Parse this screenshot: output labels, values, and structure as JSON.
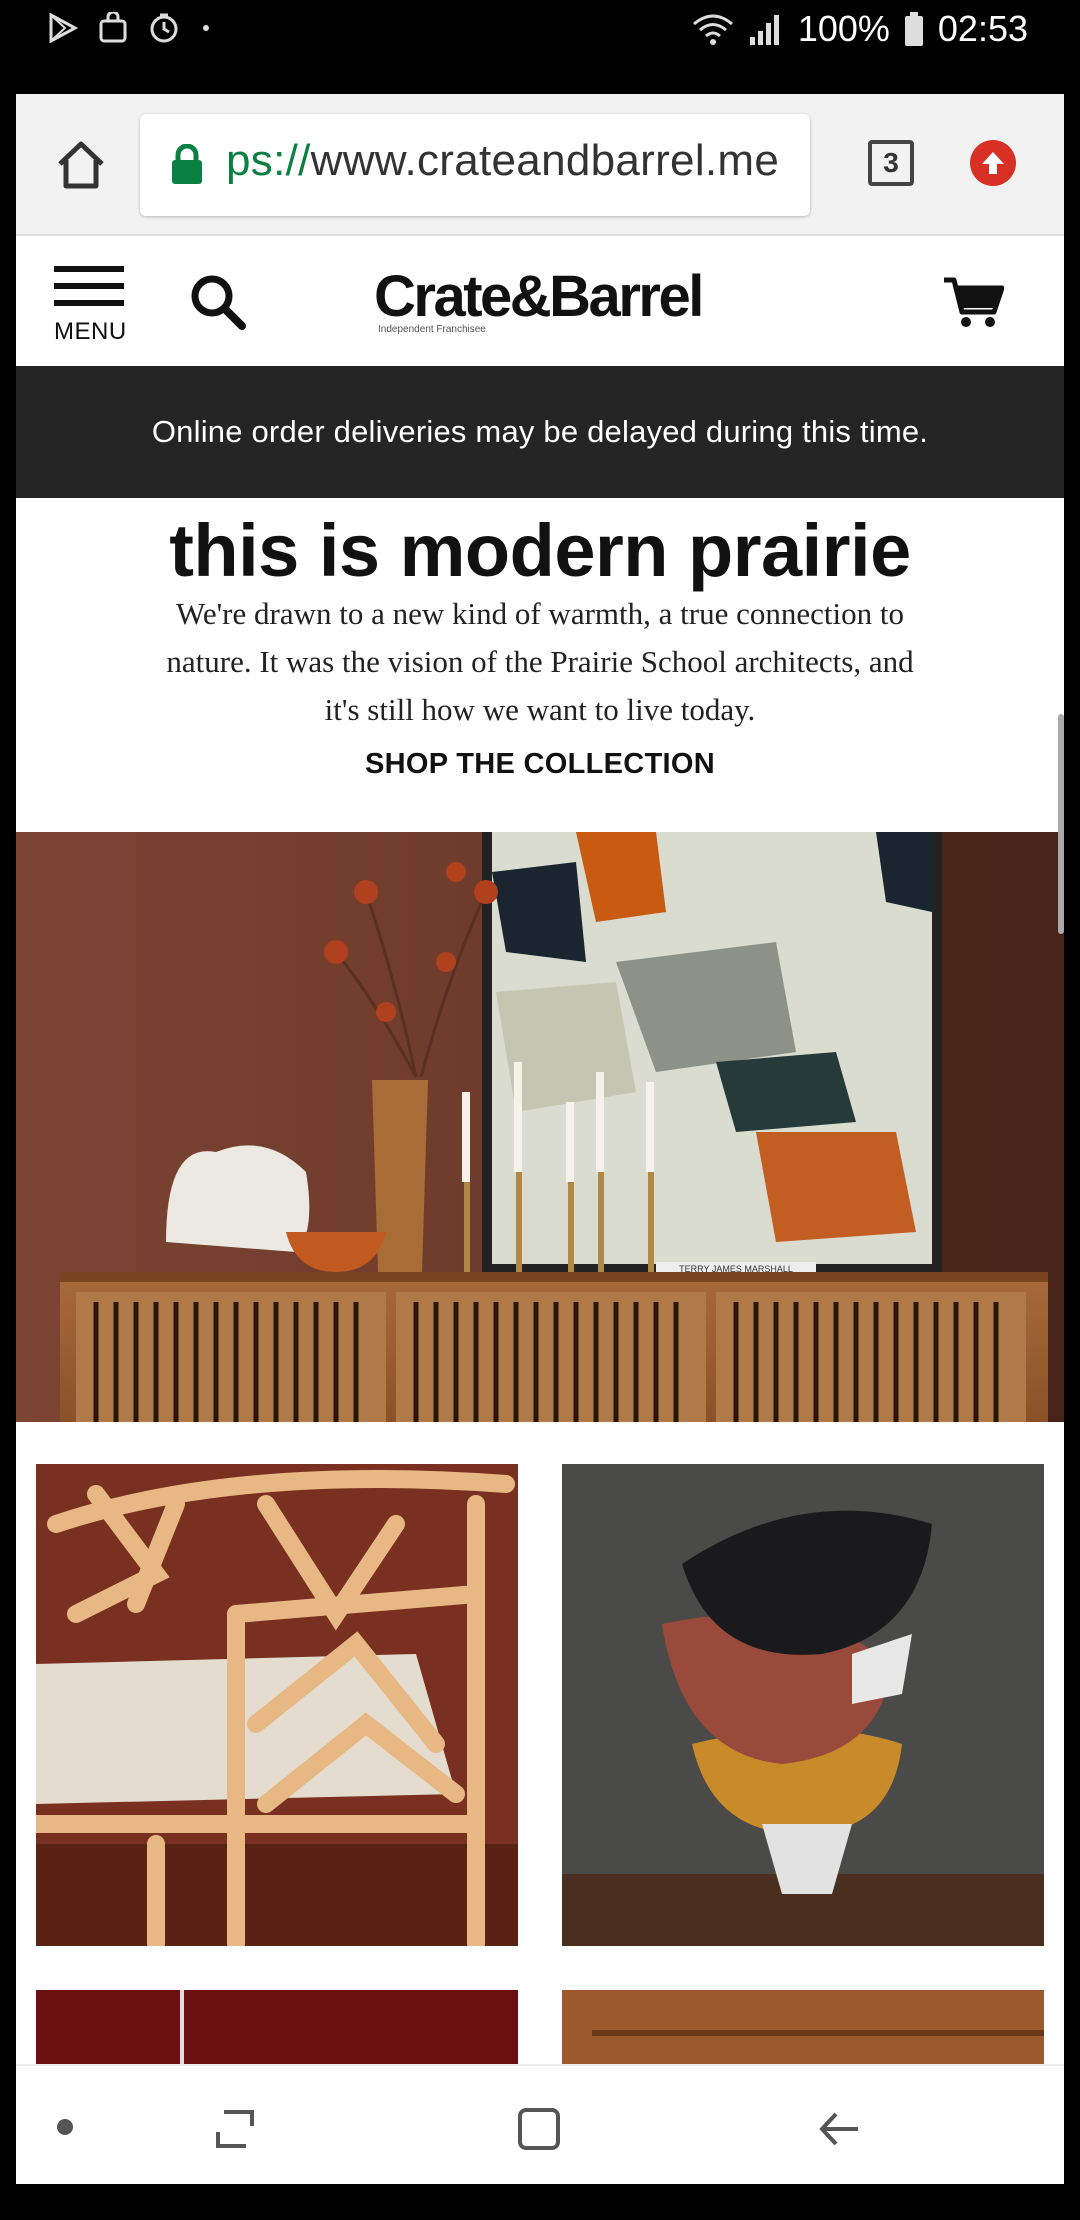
{
  "status_bar": {
    "battery": "100%",
    "time": "02:53",
    "icons": [
      "play-store-icon",
      "bag-icon",
      "timer-icon",
      "dot-icon",
      "wifi-icon",
      "signal-icon",
      "battery-icon"
    ]
  },
  "browser": {
    "url_scheme_visible": "ps://",
    "url_host": "www.crateandbarrel.me",
    "tab_count": "3",
    "icons": [
      "home-icon",
      "lock-icon",
      "tabs-icon",
      "upgrade-icon"
    ]
  },
  "header": {
    "menu_label": "MENU",
    "logo_text": "Crate&Barrel",
    "logo_subtext": "Independent Franchisee",
    "icons": [
      "menu-icon",
      "search-icon",
      "cart-icon"
    ]
  },
  "notice": {
    "text": "Online order deliveries may be delayed during this time."
  },
  "hero": {
    "title": "this is modern prairie",
    "body": "We're drawn to a new kind of warmth, a true connection to nature. It was the vision of the Prairie School architects, and it's still how we want to live today.",
    "cta": "SHOP THE COLLECTION",
    "artwork_caption": "TERRY JAMES MARSHALL"
  },
  "nav_bar": {
    "icons": [
      "dot-icon",
      "recents-icon",
      "home-square-icon",
      "back-icon"
    ]
  },
  "colors": {
    "notice_bg": "#252525",
    "url_scheme": "#0b8043",
    "upgrade": "#d93025"
  }
}
